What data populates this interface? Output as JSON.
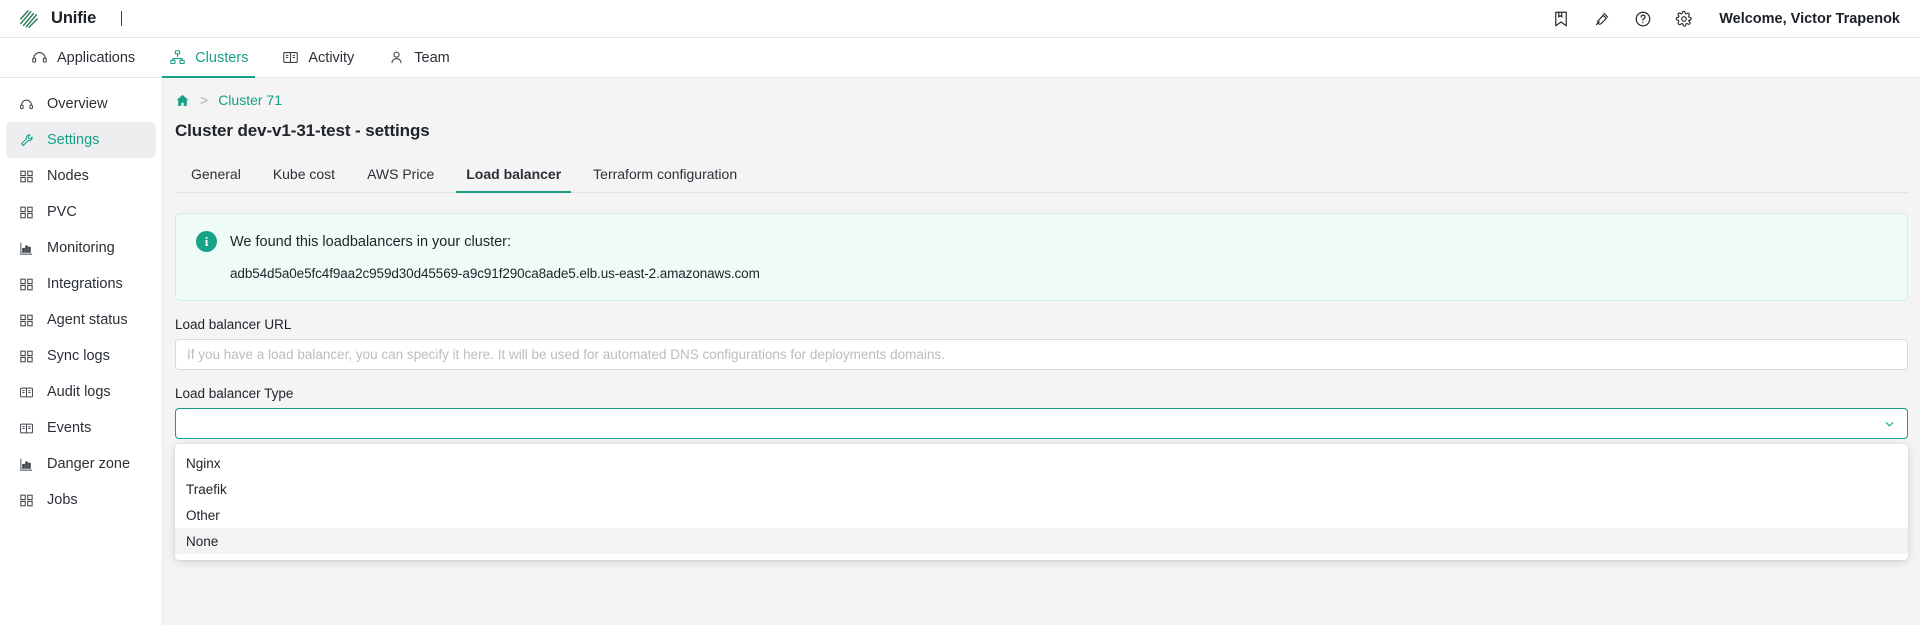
{
  "topbar": {
    "brand_name": "Unifie",
    "logo_icon": "unifie-logo-icon",
    "actions": [
      {
        "icon": "bookmark-icon",
        "name": "bookmark-button"
      },
      {
        "icon": "plug-icon",
        "name": "plug-button"
      },
      {
        "icon": "help-circle-icon",
        "name": "help-button"
      },
      {
        "icon": "gear-icon",
        "name": "settings-button"
      }
    ],
    "welcome": "Welcome, Victor Trapenok"
  },
  "topnav": {
    "items": [
      {
        "label": "Applications",
        "icon": "applications-icon",
        "active": false
      },
      {
        "label": "Clusters",
        "icon": "clusters-icon",
        "active": true
      },
      {
        "label": "Activity",
        "icon": "activity-icon",
        "active": false
      },
      {
        "label": "Team",
        "icon": "team-icon",
        "active": false
      }
    ]
  },
  "sidebar": {
    "items": [
      {
        "label": "Overview",
        "icon": "overview-icon",
        "active": false
      },
      {
        "label": "Settings",
        "icon": "wrench-icon",
        "active": true
      },
      {
        "label": "Nodes",
        "icon": "grid-icon",
        "active": false
      },
      {
        "label": "PVC",
        "icon": "grid-icon",
        "active": false
      },
      {
        "label": "Monitoring",
        "icon": "chart-icon",
        "active": false
      },
      {
        "label": "Integrations",
        "icon": "grid-icon",
        "active": false
      },
      {
        "label": "Agent status",
        "icon": "grid-icon",
        "active": false
      },
      {
        "label": "Sync logs",
        "icon": "grid-icon",
        "active": false
      },
      {
        "label": "Audit logs",
        "icon": "book-icon",
        "active": false
      },
      {
        "label": "Events",
        "icon": "book-icon",
        "active": false
      },
      {
        "label": "Danger zone",
        "icon": "chart-icon",
        "active": false
      },
      {
        "label": "Jobs",
        "icon": "grid-icon",
        "active": false
      }
    ]
  },
  "breadcrumb": {
    "home_icon": "home-icon",
    "separator": ">",
    "link": "Cluster 71"
  },
  "page": {
    "title": "Cluster dev-v1-31-test - settings"
  },
  "tabs": [
    {
      "label": "General",
      "active": false
    },
    {
      "label": "Kube cost",
      "active": false
    },
    {
      "label": "AWS Price",
      "active": false
    },
    {
      "label": "Load balancer",
      "active": true
    },
    {
      "label": "Terraform configuration",
      "active": false
    }
  ],
  "alert": {
    "icon": "info-icon",
    "icon_glyph": "i",
    "title": "We found this loadbalancers in your cluster:",
    "value": "adb54d5a0e5fc4f9aa2c959d30d45569-a9c91f290ca8ade5.elb.us-east-2.amazonaws.com"
  },
  "form": {
    "url_label": "Load balancer URL",
    "url_value": "",
    "url_placeholder": "If you have a load balancer, you can specify it here. It will be used for automated DNS configurations for deployments domains.",
    "type_label": "Load balancer Type",
    "type_value": "",
    "type_caret_icon": "chevron-down-icon",
    "type_options": [
      {
        "label": "Nginx",
        "highlighted": false
      },
      {
        "label": "Traefik",
        "highlighted": false
      },
      {
        "label": "Other",
        "highlighted": false
      },
      {
        "label": "None",
        "highlighted": true
      }
    ]
  },
  "colors": {
    "accent": "#17a086",
    "alert_bg": "#effbf7",
    "page_bg": "#f4f4f4"
  }
}
